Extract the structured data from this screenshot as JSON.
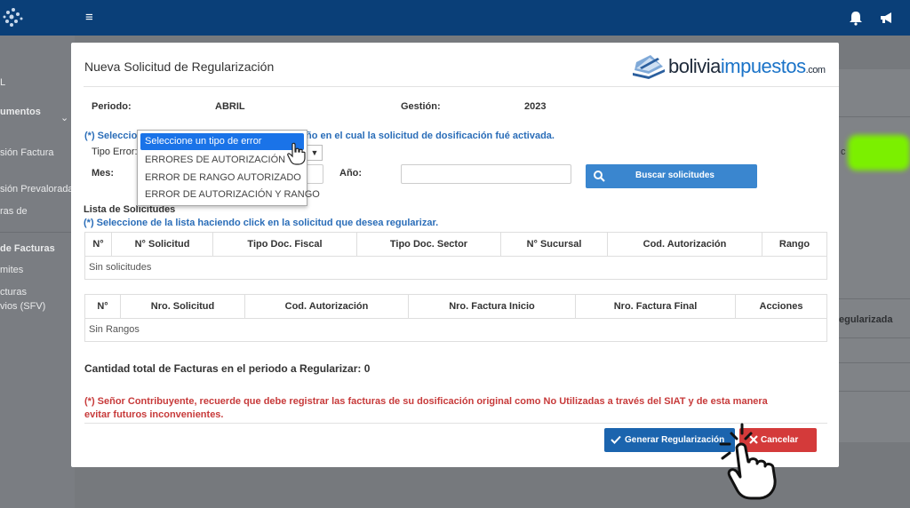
{
  "app": {
    "sidebar": {
      "items": [
        "L",
        "umentos",
        "sión Factura",
        "sión Prevalorada",
        "ras de",
        "de Facturas",
        "mites",
        "cturas",
        "vios (SFV)"
      ]
    },
    "bg_column_header": "egularizada",
    "bg_fragment": "c"
  },
  "modal": {
    "title": "Nueva Solicitud de Regularización",
    "brand": {
      "part1": "bolivia",
      "part2": "impuestos",
      "suffix": ".com"
    },
    "periodo_label": "Periodo:",
    "periodo_value": "ABRIL",
    "gestion_label": "Gestión:",
    "gestion_value": "2023",
    "note_prefix": "(*) Seleccion",
    "note_suffix": "ño en el cual la solicitud de dosificación fué activada.",
    "tipo_error_label": "Tipo Error:",
    "mes_label": "Mes:",
    "anio_label": "Año:",
    "search_button": "Buscar solicitudes",
    "lista_label": "Lista de Solicitudes",
    "lista_note": "(*) Seleccione de la lista haciendo click en la solicitud que desea regularizar.",
    "table1": {
      "headers": [
        "N°",
        "N° Solicitud",
        "Tipo Doc. Fiscal",
        "Tipo Doc. Sector",
        "N° Sucursal",
        "Cod. Autorización",
        "Rango"
      ],
      "empty": "Sin solicitudes"
    },
    "table2": {
      "headers": [
        "N°",
        "Nro. Solicitud",
        "Cod. Autorización",
        "Nro. Factura Inicio",
        "Nro. Factura Final",
        "Acciones"
      ],
      "empty": "Sin Rangos"
    },
    "total_label": "Cantidad total de Facturas en el periodo a Regularizar: 0",
    "warning": "(*) Señor Contribuyente, recuerde que debe registrar las facturas de su dosificación original como No Utilizadas a través del SIAT y de esta manera evitar futuros inconvenientes.",
    "generate_button": "Generar Regularización",
    "cancel_button": "Cancelar",
    "dropdown": {
      "options": [
        "Seleccione un tipo de error",
        "ERRORES DE AUTORIZACIÓN",
        "ERROR DE RANGO AUTORIZADO",
        "ERROR DE AUTORIZACIÓN Y RANGO"
      ],
      "selected_index": 0
    }
  },
  "colors": {
    "topbar": "#0a3f78",
    "accent_blue": "#3a86cf",
    "generate_blue": "#1b64ae",
    "cancel_red": "#d43a3a",
    "note_blue": "#2a6db8",
    "warning_red": "#c73a3a"
  },
  "icons": [
    "app-logo-icon",
    "hamburger-icon",
    "bell-icon",
    "megaphone-icon",
    "search-icon",
    "check-icon",
    "close-icon",
    "hand-pointer-icon"
  ]
}
